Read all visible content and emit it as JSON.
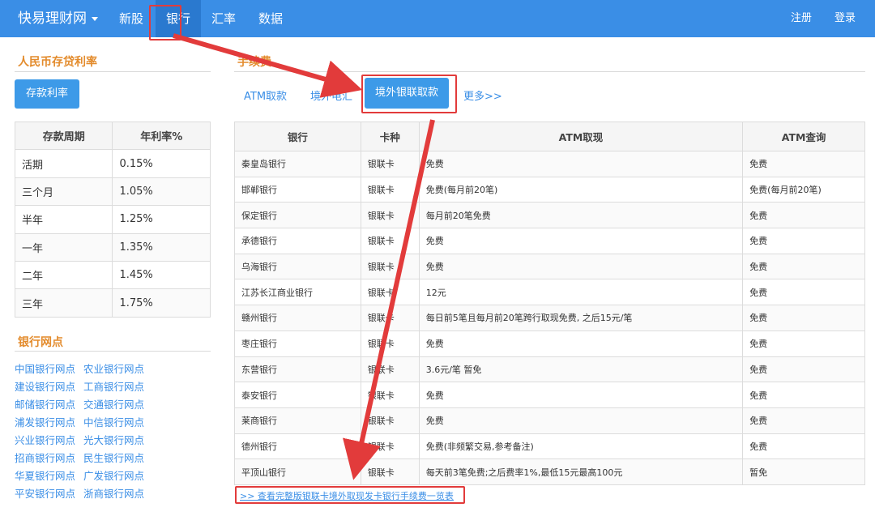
{
  "nav": {
    "brand": "快易理财网",
    "items": [
      "新股",
      "银行",
      "汇率",
      "数据"
    ],
    "right": [
      "注册",
      "登录"
    ]
  },
  "left": {
    "deposit_title": "人民币存贷利率",
    "deposit_button": "存款利率",
    "rate_headers": [
      "存款周期",
      "年利率%"
    ],
    "rates": [
      [
        "活期",
        "0.15%"
      ],
      [
        "三个月",
        "1.05%"
      ],
      [
        "半年",
        "1.25%"
      ],
      [
        "一年",
        "1.35%"
      ],
      [
        "二年",
        "1.45%"
      ],
      [
        "三年",
        "1.75%"
      ]
    ],
    "branch_title": "银行网点",
    "branch_links": [
      [
        "中国银行网点",
        "农业银行网点"
      ],
      [
        "建设银行网点",
        "工商银行网点"
      ],
      [
        "邮储银行网点",
        "交通银行网点"
      ],
      [
        "浦发银行网点",
        "中信银行网点"
      ],
      [
        "兴业银行网点",
        "光大银行网点"
      ],
      [
        "招商银行网点",
        "民生银行网点"
      ],
      [
        "华夏银行网点",
        "广发银行网点"
      ],
      [
        "平安银行网点",
        "浙商银行网点"
      ]
    ]
  },
  "main": {
    "section_title": "手续费",
    "tabs": [
      "ATM取款",
      "境外电汇",
      "境外银联取款",
      "更多>>"
    ],
    "table_headers": [
      "银行",
      "卡种",
      "ATM取现",
      "ATM查询"
    ],
    "rows": [
      [
        "秦皇岛银行",
        "银联卡",
        "免费",
        "免费"
      ],
      [
        "邯郸银行",
        "银联卡",
        "免费(每月前20笔)",
        "免费(每月前20笔)"
      ],
      [
        "保定银行",
        "银联卡",
        "每月前20笔免费",
        "免费"
      ],
      [
        "承德银行",
        "银联卡",
        "免费",
        "免费"
      ],
      [
        "乌海银行",
        "银联卡",
        "免费",
        "免费"
      ],
      [
        "江苏长江商业银行",
        "银联卡",
        "12元",
        "免费"
      ],
      [
        "赣州银行",
        "银联卡",
        "每日前5笔且每月前20笔跨行取现免费, 之后15元/笔",
        "免费"
      ],
      [
        "枣庄银行",
        "银联卡",
        "免费",
        "免费"
      ],
      [
        "东营银行",
        "银联卡",
        "3.6元/笔 暂免",
        "免费"
      ],
      [
        "泰安银行",
        "银联卡",
        "免费",
        "免费"
      ],
      [
        "莱商银行",
        "银联卡",
        "免费",
        "免费"
      ],
      [
        "德州银行",
        "银联卡",
        "免费(非频繁交易,参考备注)",
        "免费"
      ],
      [
        "平顶山银行",
        "银联卡",
        "每天前3笔免费;之后费率1%,最低15元最高100元",
        "暂免"
      ]
    ],
    "footer_link": ">> 查看完整版银联卡境外取现发卡银行手续费一览表"
  },
  "colors": {
    "nav_bg": "#3a8ee6",
    "accent_orange": "#e38b2c",
    "annotation_red": "#e23b3b"
  }
}
